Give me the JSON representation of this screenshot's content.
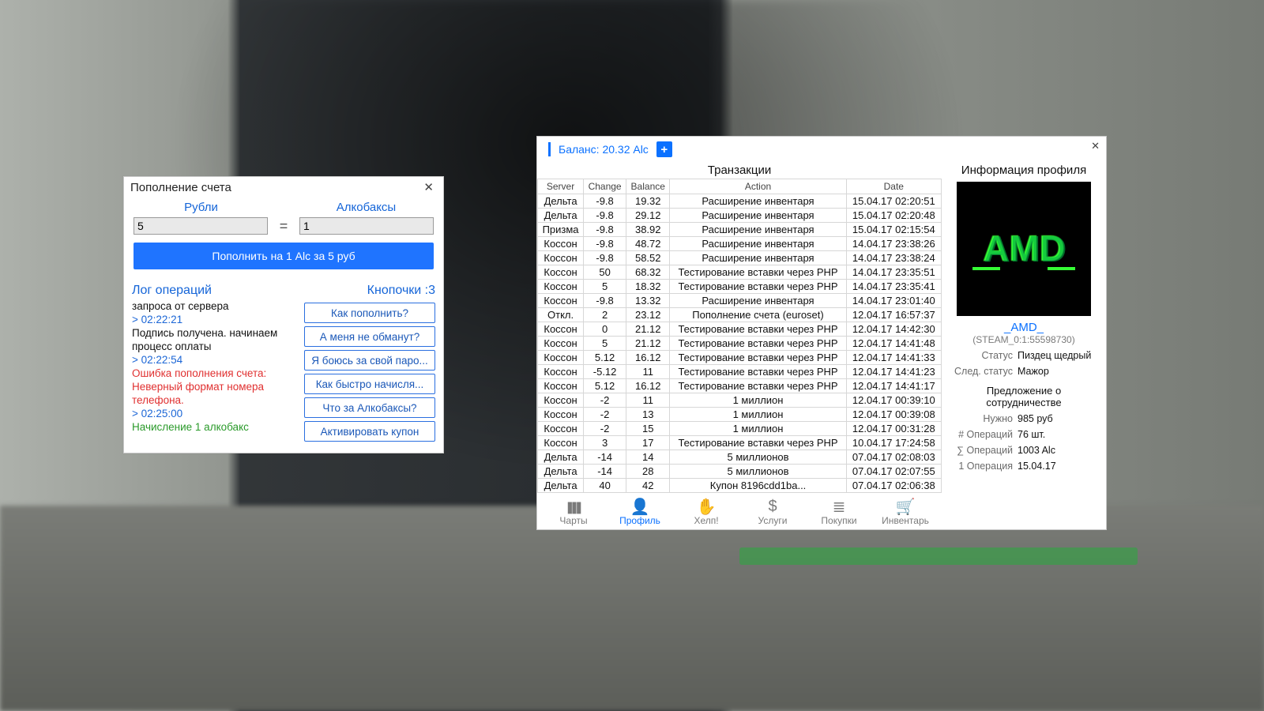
{
  "popup": {
    "title": "Пополнение счета",
    "rub_label": "Рубли",
    "alc_label": "Алкобаксы",
    "rub_value": "5",
    "alc_value": "1",
    "eq": "=",
    "button": "Пополнить на 1 Alc за 5 руб",
    "log_title": "Лог операций",
    "side_title": "Кнопочки :3",
    "log": [
      {
        "cls": "txt",
        "t": "запроса от сервера"
      },
      {
        "cls": "ts",
        "t": "> 02:22:21"
      },
      {
        "cls": "txt",
        "t": "Подпись получена. начинаем процесс оплаты"
      },
      {
        "cls": "ts",
        "t": "> 02:22:54"
      },
      {
        "cls": "err",
        "t": "Ошибка пополнения счета: Неверный формат номера телефона."
      },
      {
        "cls": "ts",
        "t": "> 02:25:00"
      },
      {
        "cls": "ok",
        "t": "Начисление 1 алкобакс"
      }
    ],
    "side_buttons": [
      "Как пополнить?",
      "А меня не обманут?",
      "Я боюсь за свой паро...",
      "Как быстро начисля...",
      "Что за Алкобаксы?",
      "Активировать купон"
    ]
  },
  "panel": {
    "balance": "Баланс: 20.32 Alc",
    "title": "Транзакции",
    "plus": "+",
    "headers": [
      "Server",
      "Change",
      "Balance",
      "Action",
      "Date"
    ],
    "rows": [
      [
        "Дельта",
        "-9.8",
        "19.32",
        "Расширение инвентаря",
        "15.04.17 02:20:51"
      ],
      [
        "Дельта",
        "-9.8",
        "29.12",
        "Расширение инвентаря",
        "15.04.17 02:20:48"
      ],
      [
        "Призма",
        "-9.8",
        "38.92",
        "Расширение инвентаря",
        "15.04.17 02:15:54"
      ],
      [
        "Коссон",
        "-9.8",
        "48.72",
        "Расширение инвентаря",
        "14.04.17 23:38:26"
      ],
      [
        "Коссон",
        "-9.8",
        "58.52",
        "Расширение инвентаря",
        "14.04.17 23:38:24"
      ],
      [
        "Коссон",
        "50",
        "68.32",
        "Тестирование вставки через PHP",
        "14.04.17 23:35:51"
      ],
      [
        "Коссон",
        "5",
        "18.32",
        "Тестирование вставки через PHP",
        "14.04.17 23:35:41"
      ],
      [
        "Коссон",
        "-9.8",
        "13.32",
        "Расширение инвентаря",
        "14.04.17 23:01:40"
      ],
      [
        "Откл.",
        "2",
        "23.12",
        "Пополнение счета (euroset)",
        "12.04.17 16:57:37"
      ],
      [
        "Коссон",
        "0",
        "21.12",
        "Тестирование вставки через PHP",
        "12.04.17 14:42:30"
      ],
      [
        "Коссон",
        "5",
        "21.12",
        "Тестирование вставки через PHP",
        "12.04.17 14:41:48"
      ],
      [
        "Коссон",
        "5.12",
        "16.12",
        "Тестирование вставки через PHP",
        "12.04.17 14:41:33"
      ],
      [
        "Коссон",
        "-5.12",
        "11",
        "Тестирование вставки через PHP",
        "12.04.17 14:41:23"
      ],
      [
        "Коссон",
        "5.12",
        "16.12",
        "Тестирование вставки через PHP",
        "12.04.17 14:41:17"
      ],
      [
        "Коссон",
        "-2",
        "11",
        "1 миллион",
        "12.04.17 00:39:10"
      ],
      [
        "Коссон",
        "-2",
        "13",
        "1 миллион",
        "12.04.17 00:39:08"
      ],
      [
        "Коссон",
        "-2",
        "15",
        "1 миллион",
        "12.04.17 00:31:28"
      ],
      [
        "Коссон",
        "3",
        "17",
        "Тестирование вставки через PHP",
        "10.04.17 17:24:58"
      ],
      [
        "Дельта",
        "-14",
        "14",
        "5 миллионов",
        "07.04.17 02:08:03"
      ],
      [
        "Дельта",
        "-14",
        "28",
        "5 миллионов",
        "07.04.17 02:07:55"
      ],
      [
        "Дельта",
        "40",
        "42",
        "Купон 8196cdd1ba...",
        "07.04.17 02:06:38"
      ]
    ],
    "nav": [
      {
        "icon_key": "charts",
        "label": "Чарты"
      },
      {
        "icon_key": "profile",
        "label": "Профиль",
        "active": true
      },
      {
        "icon_key": "help",
        "label": "Хелп!"
      },
      {
        "icon_key": "services",
        "label": "Услуги"
      },
      {
        "icon_key": "purchases",
        "label": "Покупки"
      },
      {
        "icon_key": "inventory",
        "label": "Инвентарь"
      }
    ]
  },
  "profile": {
    "heading": "Информация профиля",
    "avatar_text": "AMD",
    "username": "_AMD_",
    "steam": "(STEAM_0:1:55598730)",
    "status_k": "Статус",
    "status_v": "Пиздец щедрый",
    "next_k": "След. статус",
    "next_v": "Мажор",
    "proposal1": "Предложение о",
    "proposal2": "сотрудничестве",
    "need_k": "Нужно",
    "need_v": "985 руб",
    "opsn_k": "# Операций",
    "opsn_v": "76 шт.",
    "opss_k": "∑ Операций",
    "opss_v": "1003 Alc",
    "op1_k": "1 Операция",
    "op1_v": "15.04.17"
  },
  "icons": {
    "charts": "▮▮▮",
    "profile": "👤",
    "help": "✋",
    "services": "$",
    "purchases": "≣",
    "inventory": "🛒"
  }
}
